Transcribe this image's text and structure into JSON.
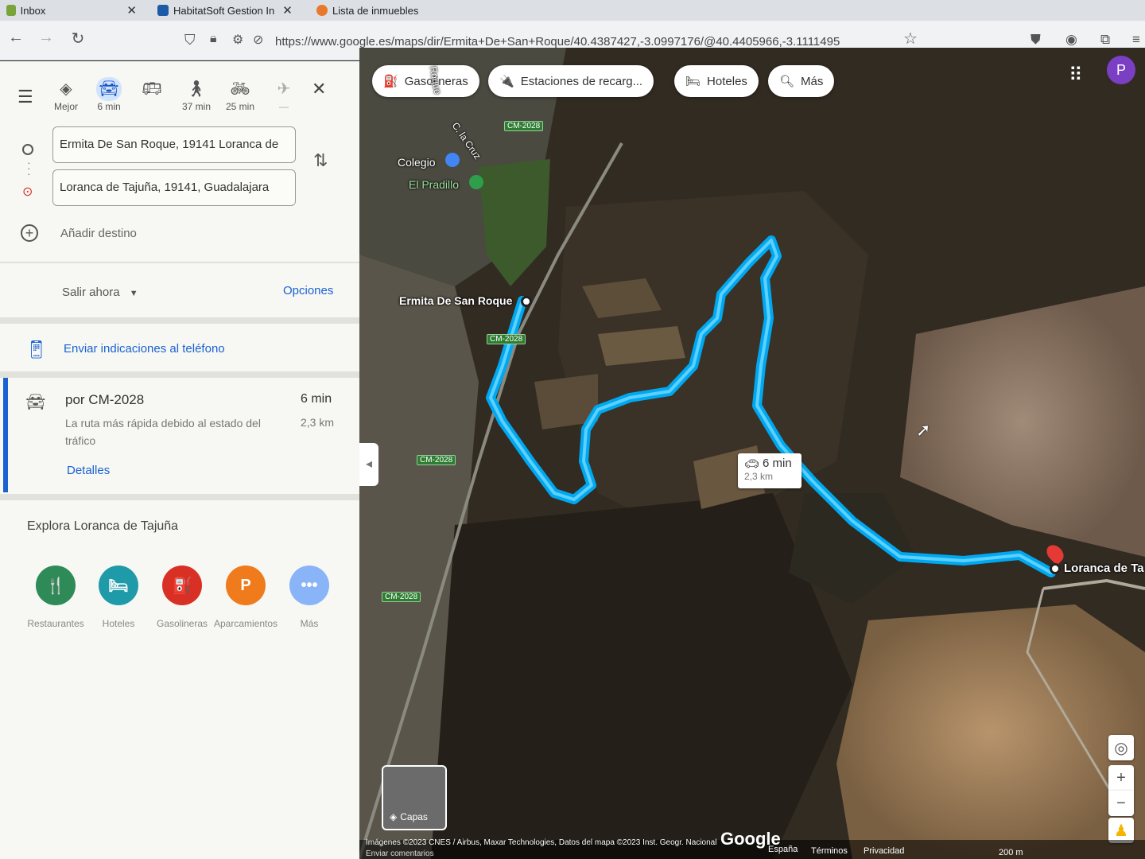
{
  "browser": {
    "tabs": [
      {
        "label": "Inbox",
        "favicon_color": "#7aa33a"
      },
      {
        "label": "HabitatSoft Gestion In",
        "favicon_color": "#1c5aa8"
      },
      {
        "label": "Lista de inmuebles",
        "favicon_color": "#e8792b"
      }
    ],
    "url": "https://www.google.es/maps/dir/Ermita+De+San+Roque/40.4387427,-3.0997176/@40.4405966,-3.1111495"
  },
  "panel": {
    "modes": [
      {
        "label": "Mejor",
        "icon": "diamond-turn-icon"
      },
      {
        "label": "6 min",
        "icon": "car-icon",
        "selected": true
      },
      {
        "label": "",
        "icon": "bus-icon"
      },
      {
        "label": "37 min",
        "icon": "walk-icon"
      },
      {
        "label": "25 min",
        "icon": "bike-icon"
      },
      {
        "label": "—",
        "icon": "plane-icon"
      }
    ],
    "origin": "Ermita De San Roque, 19141 Loranca de",
    "destination": "Loranca de Tajuña, 19141, Guadalajara",
    "add_destination": "Añadir destino",
    "depart": "Salir ahora",
    "options": "Opciones",
    "send_phone": "Enviar indicaciones al teléfono",
    "route": {
      "title": "por CM-2028",
      "time": "6 min",
      "distance": "2,3 km",
      "note": "La ruta más rápida debido al estado del tráfico",
      "details": "Detalles"
    },
    "explore_title": "Explora Loranca de Tajuña",
    "categories": [
      {
        "label": "Restaurantes",
        "color": "#2e8b57",
        "glyph": "🍴"
      },
      {
        "label": "Hoteles",
        "color": "#1f9aa8",
        "glyph": "🛏"
      },
      {
        "label": "Gasolineras",
        "color": "#d93025",
        "glyph": "⛽"
      },
      {
        "label": "Aparcamientos",
        "color": "#ef7b1c",
        "glyph": "P"
      },
      {
        "label": "Más",
        "color": "#8ab4f8",
        "glyph": "•••"
      }
    ]
  },
  "map": {
    "chips": [
      "Gasolineras",
      "Estaciones de recarg...",
      "Hoteles",
      "Más"
    ],
    "labels": {
      "colegio": "Colegio",
      "pradillo": "El Pradillo",
      "origin": "Ermita De San Roque",
      "destination": "Loranca de Ta",
      "road": "CM-2028",
      "street1": "C. la Cruz",
      "street2": "Roque"
    },
    "route_box": {
      "time": "6 min",
      "distance": "2,3 km"
    },
    "layers": "Capas",
    "attribution": "Imágenes ©2023 CNES / Airbus, Maxar Technologies, Datos del mapa ©2023 Inst. Geogr. Nacional",
    "feedback": "Enviar comentarios",
    "google": "Google",
    "footer": [
      "España",
      "Términos",
      "Privacidad"
    ],
    "scale": "200 m",
    "avatar": "P"
  }
}
